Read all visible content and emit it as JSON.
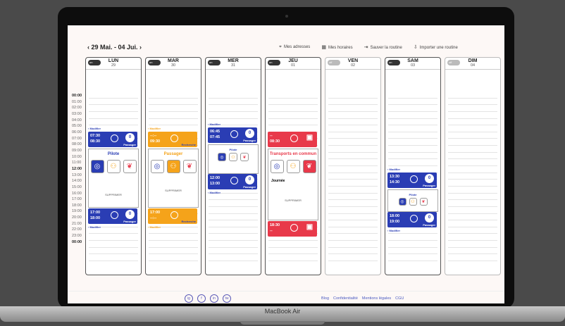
{
  "device_label": "MacBook Air",
  "header": {
    "date_range": "29 Mai. - 04 Jui.",
    "links": [
      "Mes adresses",
      "Mes horaires",
      "Sauver la routine",
      "Importer une routine"
    ]
  },
  "hours": [
    "00:00",
    "01:00",
    "02:00",
    "03:00",
    "04:00",
    "05:00",
    "06:00",
    "07:00",
    "08:00",
    "09:00",
    "10:00",
    "11:00",
    "12:00",
    "13:00",
    "14:00",
    "15:00",
    "16:00",
    "17:00",
    "18:00",
    "19:00",
    "20:00",
    "21:00",
    "22:00",
    "23:00",
    "00:00"
  ],
  "days": [
    {
      "name": "LUN",
      "num": "29",
      "toggle": "on"
    },
    {
      "name": "MAR",
      "num": "30",
      "toggle": "on"
    },
    {
      "name": "MER",
      "num": "31",
      "toggle": "on"
    },
    {
      "name": "JEU",
      "num": "01",
      "toggle": "on"
    },
    {
      "name": "VEN",
      "num": "02",
      "toggle": "off"
    },
    {
      "name": "SAM",
      "num": "03",
      "toggle": "on"
    },
    {
      "name": "DIM",
      "num": "04",
      "toggle": "off"
    }
  ],
  "mon": {
    "modify": "› Modifier",
    "t1": "07:30",
    "t2": "08:30",
    "count": "0",
    "role": "Passager",
    "panel_title": "Pilote",
    "delete": "SUPPRIMER",
    "r1": "17:00",
    "r2": "18:00",
    "modify2": "› Modifier"
  },
  "tue": {
    "modify": "› Modifier",
    "t1": "--:--",
    "t2": "09:30",
    "role": "Recherche",
    "panel_title": "Passager",
    "delete": "SUPPRIMER",
    "r1": "17:00",
    "r2": "--:--",
    "modify2": "› Modifier"
  },
  "wed": {
    "modify": "› Modifier",
    "t1": "06:45",
    "t2": "07:45",
    "count": "0",
    "role": "Passager",
    "panel_title": "Pilote",
    "r1": "12:00",
    "r2": "13:00",
    "modify2": "› Modifier"
  },
  "thu": {
    "t1": "--",
    "t2": "08:30",
    "panel_title": "Transports en commun",
    "sel": "Journée",
    "delete": "SUPPRIMER",
    "r1": "18:30",
    "r2": "--"
  },
  "sat": {
    "modify": "› Modifier",
    "t1": "13:30",
    "t2": "14:30",
    "count": "0",
    "role": "Passager",
    "panel_title": "Pilote",
    "r1": "18:00",
    "r2": "19:00",
    "modify2": "› Modifier"
  },
  "footer": {
    "links": [
      "Blog",
      "Confidentialité",
      "Mentions légales",
      "CGU"
    ],
    "social": [
      "ig",
      "f",
      "in",
      "tw"
    ]
  }
}
